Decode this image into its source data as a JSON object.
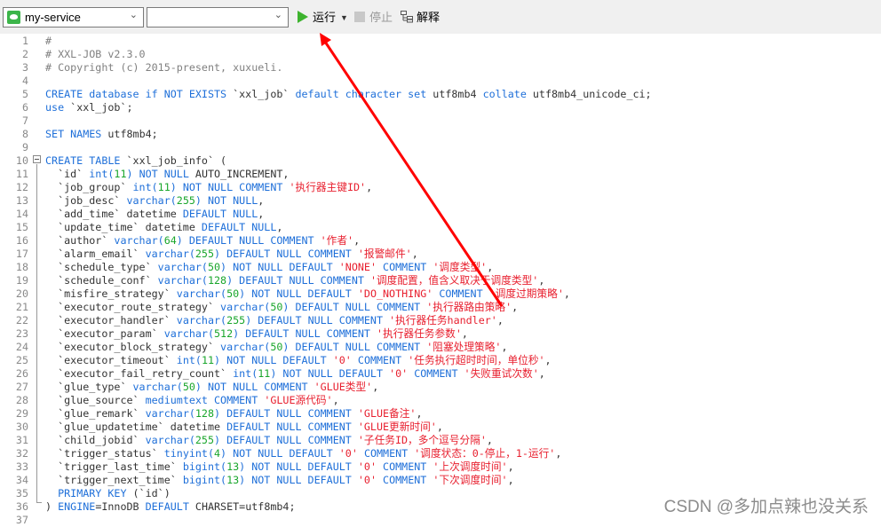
{
  "toolbar": {
    "connection_select": "my-service",
    "database_select": "",
    "run_label": "运行",
    "stop_label": "停止",
    "explain_label": "解释"
  },
  "editor": {
    "lines": [
      {
        "n": "1",
        "html": "<span class='c'>#</span>"
      },
      {
        "n": "2",
        "html": "<span class='c'># XXL-JOB v2.3.0</span>"
      },
      {
        "n": "3",
        "html": "<span class='c'># Copyright (c) 2015-present, xuxueli.</span>"
      },
      {
        "n": "4",
        "html": ""
      },
      {
        "n": "5",
        "html": "<span class='k'>CREATE database if NOT EXISTS</span> `xxl_job` <span class='k'>default character set</span> utf8mb4 <span class='k'>collate</span> utf8mb4_unicode_ci;"
      },
      {
        "n": "6",
        "html": "<span class='k'>use</span> `xxl_job`;"
      },
      {
        "n": "7",
        "html": ""
      },
      {
        "n": "8",
        "html": "<span class='k'>SET NAMES</span> utf8mb4;"
      },
      {
        "n": "9",
        "html": ""
      },
      {
        "n": "10",
        "html": "<span class='k'>CREATE TABLE</span> `xxl_job_info` ("
      },
      {
        "n": "11",
        "html": "  `id` <span class='k'>int(</span><span class='n'>11</span><span class='k'>) NOT NULL</span> AUTO_INCREMENT,"
      },
      {
        "n": "12",
        "html": "  `job_group` <span class='k'>int(</span><span class='n'>11</span><span class='k'>) NOT NULL COMMENT</span> <span class='s'>'执行器主键ID'</span>,"
      },
      {
        "n": "13",
        "html": "  `job_desc` <span class='k'>varchar(</span><span class='n'>255</span><span class='k'>) NOT NULL</span>,"
      },
      {
        "n": "14",
        "html": "  `add_time` datetime <span class='k'>DEFAULT NULL</span>,"
      },
      {
        "n": "15",
        "html": "  `update_time` datetime <span class='k'>DEFAULT NULL</span>,"
      },
      {
        "n": "16",
        "html": "  `author` <span class='k'>varchar(</span><span class='n'>64</span><span class='k'>) DEFAULT NULL COMMENT</span> <span class='s'>'作者'</span>,"
      },
      {
        "n": "17",
        "html": "  `alarm_email` <span class='k'>varchar(</span><span class='n'>255</span><span class='k'>) DEFAULT NULL COMMENT</span> <span class='s'>'报警邮件'</span>,"
      },
      {
        "n": "18",
        "html": "  `schedule_type` <span class='k'>varchar(</span><span class='n'>50</span><span class='k'>) NOT NULL DEFAULT</span> <span class='s'>'NONE'</span> <span class='k'>COMMENT</span> <span class='s'>'调度类型'</span>,"
      },
      {
        "n": "19",
        "html": "  `schedule_conf` <span class='k'>varchar(</span><span class='n'>128</span><span class='k'>) DEFAULT NULL COMMENT</span> <span class='s'>'调度配置，值含义取决于调度类型'</span>,"
      },
      {
        "n": "20",
        "html": "  `misfire_strategy` <span class='k'>varchar(</span><span class='n'>50</span><span class='k'>) NOT NULL DEFAULT</span> <span class='s'>'DO_NOTHING'</span> <span class='k'>COMMENT</span> <span class='s'>'调度过期策略'</span>,"
      },
      {
        "n": "21",
        "html": "  `executor_route_strategy` <span class='k'>varchar(</span><span class='n'>50</span><span class='k'>) DEFAULT NULL COMMENT</span> <span class='s'>'执行器路由策略'</span>,"
      },
      {
        "n": "22",
        "html": "  `executor_handler` <span class='k'>varchar(</span><span class='n'>255</span><span class='k'>) DEFAULT NULL COMMENT</span> <span class='s'>'执行器任务handler'</span>,"
      },
      {
        "n": "23",
        "html": "  `executor_param` <span class='k'>varchar(</span><span class='n'>512</span><span class='k'>) DEFAULT NULL COMMENT</span> <span class='s'>'执行器任务参数'</span>,"
      },
      {
        "n": "24",
        "html": "  `executor_block_strategy` <span class='k'>varchar(</span><span class='n'>50</span><span class='k'>) DEFAULT NULL COMMENT</span> <span class='s'>'阻塞处理策略'</span>,"
      },
      {
        "n": "25",
        "html": "  `executor_timeout` <span class='k'>int(</span><span class='n'>11</span><span class='k'>) NOT NULL DEFAULT</span> <span class='s'>'0'</span> <span class='k'>COMMENT</span> <span class='s'>'任务执行超时时间，单位秒'</span>,"
      },
      {
        "n": "26",
        "html": "  `executor_fail_retry_count` <span class='k'>int(</span><span class='n'>11</span><span class='k'>) NOT NULL DEFAULT</span> <span class='s'>'0'</span> <span class='k'>COMMENT</span> <span class='s'>'失败重试次数'</span>,"
      },
      {
        "n": "27",
        "html": "  `glue_type` <span class='k'>varchar(</span><span class='n'>50</span><span class='k'>) NOT NULL COMMENT</span> <span class='s'>'GLUE类型'</span>,"
      },
      {
        "n": "28",
        "html": "  `glue_source` <span class='k'>mediumtext COMMENT</span> <span class='s'>'GLUE源代码'</span>,"
      },
      {
        "n": "29",
        "html": "  `glue_remark` <span class='k'>varchar(</span><span class='n'>128</span><span class='k'>) DEFAULT NULL COMMENT</span> <span class='s'>'GLUE备注'</span>,"
      },
      {
        "n": "30",
        "html": "  `glue_updatetime` datetime <span class='k'>DEFAULT NULL COMMENT</span> <span class='s'>'GLUE更新时间'</span>,"
      },
      {
        "n": "31",
        "html": "  `child_jobid` <span class='k'>varchar(</span><span class='n'>255</span><span class='k'>) DEFAULT NULL COMMENT</span> <span class='s'>'子任务ID，多个逗号分隔'</span>,"
      },
      {
        "n": "32",
        "html": "  `trigger_status` <span class='k'>tinyint(</span><span class='n'>4</span><span class='k'>) NOT NULL DEFAULT</span> <span class='s'>'0'</span> <span class='k'>COMMENT</span> <span class='s'>'调度状态：0-停止，1-运行'</span>,"
      },
      {
        "n": "33",
        "html": "  `trigger_last_time` <span class='k'>bigint(</span><span class='n'>13</span><span class='k'>) NOT NULL DEFAULT</span> <span class='s'>'0'</span> <span class='k'>COMMENT</span> <span class='s'>'上次调度时间'</span>,"
      },
      {
        "n": "34",
        "html": "  `trigger_next_time` <span class='k'>bigint(</span><span class='n'>13</span><span class='k'>) NOT NULL DEFAULT</span> <span class='s'>'0'</span> <span class='k'>COMMENT</span> <span class='s'>'下次调度时间'</span>,"
      },
      {
        "n": "35",
        "html": "  <span class='k'>PRIMARY KEY</span> (`id`)"
      },
      {
        "n": "36",
        "html": ") <span class='k'>ENGINE</span>=InnoDB <span class='k'>DEFAULT</span> CHARSET=utf8mb4;"
      },
      {
        "n": "37",
        "html": ""
      }
    ]
  },
  "watermark": "CSDN @多加点辣也没关系",
  "annotation": {
    "type": "red-arrow",
    "points_to": "run-button",
    "color": "#ff0000"
  }
}
